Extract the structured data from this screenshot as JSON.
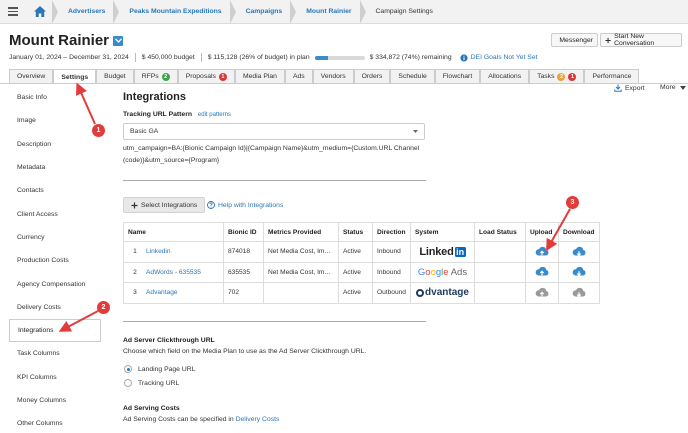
{
  "breadcrumb": [
    "Advertisers",
    "Peaks Mountain Expeditions",
    "Campaigns",
    "Mount Rainier",
    "Campaign Settings"
  ],
  "header": {
    "title": "Mount Rainier",
    "messenger_label": "Messenger",
    "new_conversation_label": "Start New Conversation",
    "dates": "January 01, 2024 – December 31, 2024",
    "budget": "$ 450,000 budget",
    "in_plan": "$ 115,128 (26% of budget) in plan",
    "plan_progress_pct": 26,
    "remaining": "$ 334,872 (74%) remaining",
    "dei_label": "DEI Goals Not Yet Set"
  },
  "tabs": [
    {
      "label": "Overview"
    },
    {
      "label": "Settings",
      "active": true
    },
    {
      "label": "Budget"
    },
    {
      "label": "RFPs",
      "badges": [
        {
          "text": "2",
          "color": "#3fa34d"
        }
      ]
    },
    {
      "label": "Proposals",
      "badges": [
        {
          "text": "1",
          "color": "#d93636"
        }
      ]
    },
    {
      "label": "Media Plan"
    },
    {
      "label": "Ads"
    },
    {
      "label": "Vendors"
    },
    {
      "label": "Orders"
    },
    {
      "label": "Schedule"
    },
    {
      "label": "Flowchart"
    },
    {
      "label": "Allocations"
    },
    {
      "label": "Tasks",
      "badges": [
        {
          "text": "2",
          "color": "#e8a33b"
        },
        {
          "text": "1",
          "color": "#d93636"
        }
      ]
    },
    {
      "label": "Performance"
    }
  ],
  "toolbar": {
    "export_label": "Export",
    "more_label": "More"
  },
  "sidenav": [
    "Basic Info",
    "Image",
    "Description",
    "Metadata",
    "Contacts",
    "Client Access",
    "Currency",
    "Production Costs",
    "Agency Compensation",
    "Delivery Costs",
    "Integrations",
    "Task Columns",
    "KPI Columns",
    "Money Columns",
    "Other Columns"
  ],
  "active_nav": "Integrations",
  "main": {
    "heading": "Integrations",
    "tracking_label": "Tracking URL Pattern",
    "edit_patterns": "edit patterns",
    "tracking_value": "Basic GA",
    "utm_text": "utm_campaign=BA:{Bionic Campaign Id}|{Campaign Name}&utm_medium={Custom.URL Channel (code)}&utm_source={Program}",
    "select_integrations": "Select Integrations",
    "help_integrations": "Help with Integrations",
    "table": {
      "headers": [
        "Name",
        "Bionic ID",
        "Metrics Provided",
        "Status",
        "Direction",
        "System",
        "Load Status",
        "Upload",
        "Download"
      ],
      "rows": [
        {
          "num": "1",
          "name": "Linkedin",
          "bionic_id": "874018",
          "metrics": "Net Media Cost, Im…",
          "status": "Active",
          "direction": "Inbound",
          "system": "LinkedIn"
        },
        {
          "num": "2",
          "name": "AdWords - 635535",
          "bionic_id": "635535",
          "metrics": "Net Media Cost, Im…",
          "status": "Active",
          "direction": "Inbound",
          "system": "Google Ads"
        },
        {
          "num": "3",
          "name": "Advantage",
          "bionic_id": "702",
          "metrics": "",
          "status": "Active",
          "direction": "Outbound",
          "system": "advantage"
        }
      ]
    },
    "clickthrough_heading": "Ad Server Clickthrough URL",
    "clickthrough_desc": "Choose which field on the Media Plan to use as the Ad Server Clickthrough URL.",
    "radio_options": [
      "Landing Page URL",
      "Tracking URL"
    ],
    "ad_serving_heading": "Ad Serving Costs",
    "ad_serving_text": "Ad Serving Costs can be specified in",
    "delivery_costs_link": "Delivery Costs"
  },
  "markers": [
    "1",
    "2",
    "3"
  ],
  "colors": {
    "link": "#2a77b8",
    "accent": "#3a8bc9",
    "marker": "#e23b3b"
  }
}
